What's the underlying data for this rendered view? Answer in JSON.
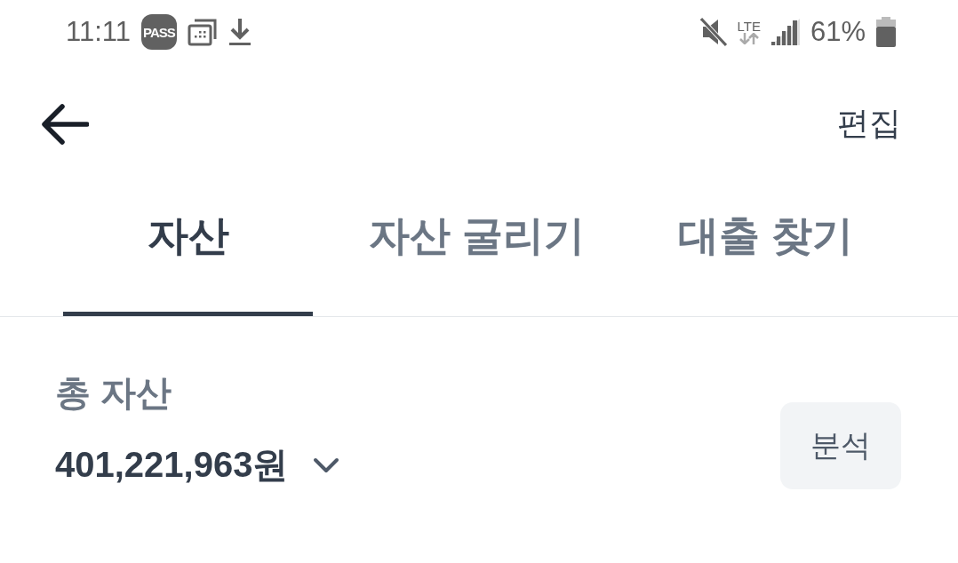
{
  "status_bar": {
    "time": "11:11",
    "pass_badge": "PASS",
    "network": "LTE",
    "battery": "61%"
  },
  "header": {
    "action": "편집"
  },
  "tabs": [
    {
      "label": "자산",
      "selected": true
    },
    {
      "label": "자산 굴리기",
      "selected": false
    },
    {
      "label": "대출 찾기",
      "selected": false
    }
  ],
  "summary": {
    "title": "총 자산",
    "amount": "401,221,963원",
    "button": "분석"
  }
}
